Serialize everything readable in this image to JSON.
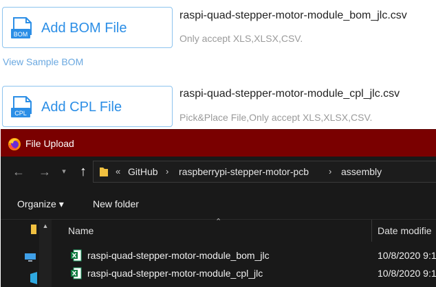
{
  "upload": {
    "bom": {
      "button_label": "Add BOM File",
      "icon_text": "BOM",
      "file_name": "raspi-quad-stepper-motor-module_bom_jlc.csv",
      "hint": "Only accept XLS,XLSX,CSV."
    },
    "sample_link": "View Sample BOM",
    "cpl": {
      "button_label": "Add CPL File",
      "icon_text": "CPL",
      "file_name": "raspi-quad-stepper-motor-module_cpl_jlc.csv",
      "hint": "Pick&Place File,Only accept XLS,XLSX,CSV."
    },
    "accent_color": "#2b8ee6"
  },
  "dialog": {
    "title": "File Upload",
    "titlebar_color": "#7a0000",
    "breadcrumb": [
      "GitHub",
      "raspberrypi-stepper-motor-pcb",
      "assembly"
    ],
    "toolbar": {
      "organize": "Organize ▾",
      "new_folder": "New folder"
    },
    "columns": {
      "name": "Name",
      "date": "Date modifie"
    },
    "files": [
      {
        "name": "raspi-quad-stepper-motor-module_bom_jlc",
        "date": "10/8/2020 9:1",
        "icon": "excel-icon"
      },
      {
        "name": "raspi-quad-stepper-motor-module_cpl_jlc",
        "date": "10/8/2020 9:1",
        "icon": "excel-icon"
      }
    ]
  }
}
